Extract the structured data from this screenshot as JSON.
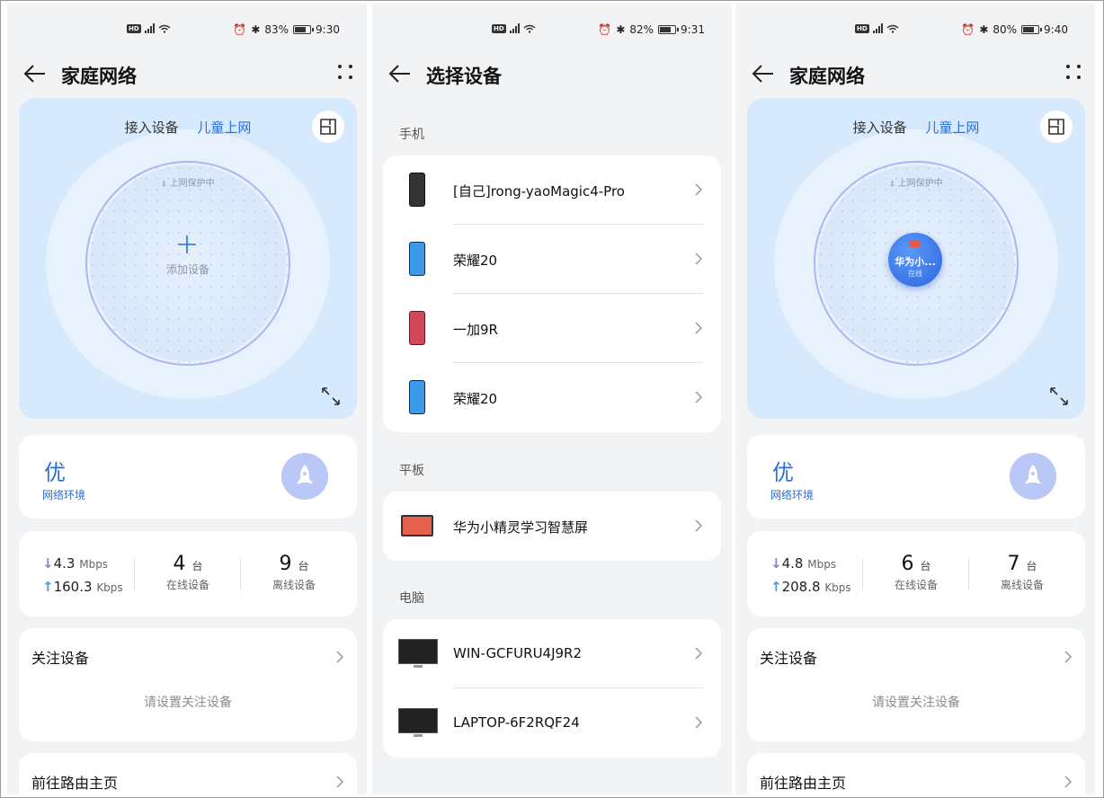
{
  "screens": [
    {
      "status": {
        "left_icons": "HD 5G",
        "alarm": "⏰",
        "bt": "✱",
        "battery_pct": "83%",
        "battery_level": 0.83,
        "time": "9:30"
      },
      "header": {
        "title": "家庭网络"
      },
      "hero": {
        "tab_access": "接入设备",
        "tab_kids": "儿童上网",
        "protect_text": "上网保护中",
        "add_label": "添加设备"
      },
      "quality": {
        "grade": "优",
        "label": "网络环境"
      },
      "stats": {
        "down_value": "4.3",
        "down_unit": "Mbps",
        "up_value": "160.3",
        "up_unit": "Kbps",
        "online_count": "4",
        "online_unit": "台",
        "online_label": "在线设备",
        "offline_count": "9",
        "offline_unit": "台",
        "offline_label": "离线设备"
      },
      "follow": {
        "title": "关注设备",
        "hint": "请设置关注设备"
      },
      "router": {
        "title": "前往路由主页"
      }
    },
    {
      "status": {
        "left_icons": "HD 5G",
        "alarm": "⏰",
        "bt": "✱",
        "battery_pct": "82%",
        "battery_level": 0.82,
        "time": "9:31"
      },
      "header": {
        "title": "选择设备"
      },
      "sections": [
        {
          "title": "手机",
          "items": [
            "[自己]rong-yaoMagic4-Pro",
            "荣耀20",
            "一加9R",
            "荣耀20"
          ]
        },
        {
          "title": "平板",
          "items": [
            "华为小精灵学习智慧屏"
          ]
        },
        {
          "title": "电脑",
          "items": [
            "WIN-GCFURU4J9R2",
            "LAPTOP-6F2RQF24"
          ]
        }
      ]
    },
    {
      "status": {
        "left_icons": "HD 5G",
        "alarm": "⏰",
        "bt": "✱",
        "battery_pct": "80%",
        "battery_level": 0.8,
        "time": "9:40"
      },
      "header": {
        "title": "家庭网络"
      },
      "hero": {
        "tab_access": "接入设备",
        "tab_kids": "儿童上网",
        "protect_text": "上网保护中",
        "device_name": "华为小...",
        "device_status": "在线"
      },
      "quality": {
        "grade": "优",
        "label": "网络环境"
      },
      "stats": {
        "down_value": "4.8",
        "down_unit": "Mbps",
        "up_value": "208.8",
        "up_unit": "Kbps",
        "online_count": "6",
        "online_unit": "台",
        "online_label": "在线设备",
        "offline_count": "7",
        "offline_unit": "台",
        "offline_label": "离线设备"
      },
      "follow": {
        "title": "关注设备",
        "hint": "请设置关注设备"
      },
      "router": {
        "title": "前往路由主页"
      }
    }
  ],
  "colors": {
    "accent": "#2a6ed8",
    "hero_bg": "#d6e9fd",
    "page_bg": "#f1f3f5"
  }
}
